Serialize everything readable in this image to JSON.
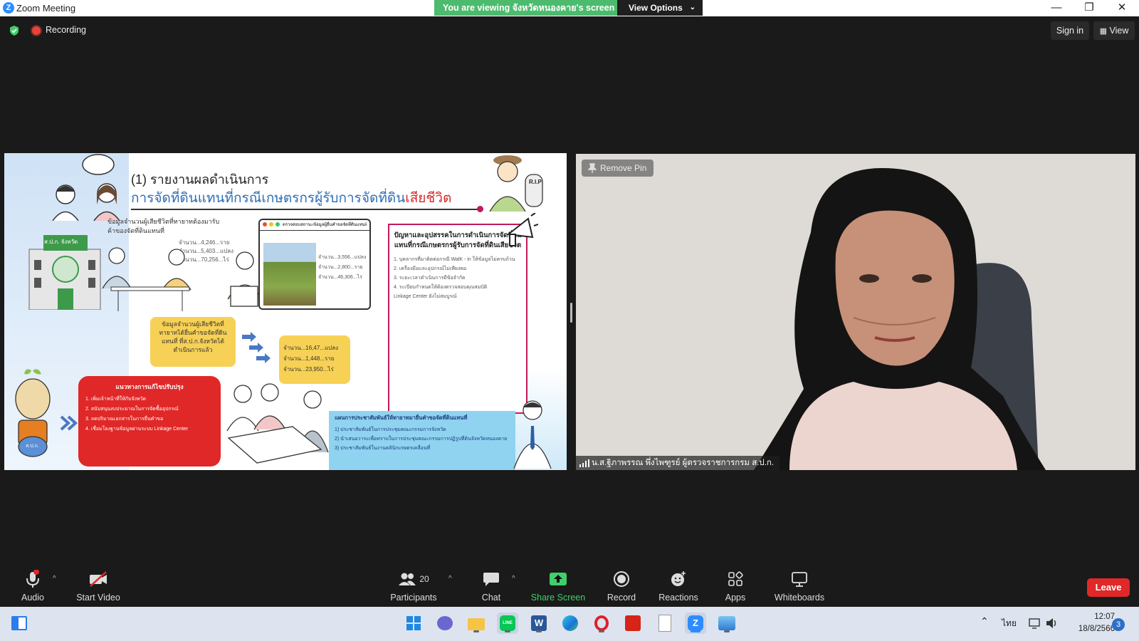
{
  "window": {
    "app_title": "Zoom Meeting",
    "viewing_banner": "You are viewing จังหวัดหนองคาย's screen",
    "view_options": "View Options",
    "controls": {
      "minimize": "—",
      "restore": "❐",
      "close": "✕"
    }
  },
  "topbar": {
    "recording_label": "Recording",
    "signin_label": "Sign in",
    "view_label": "View"
  },
  "slide": {
    "heading": "(1) รายงานผลดำเนินการ",
    "subtitle_main": "การจัดที่ดินแทนที่กรณีเกษตรกรผู้รับการจัดที่ดิน",
    "subtitle_red": "เสียชีวิต",
    "box_info_title": "ข้อมูลจำนวนผู้เสียชีวิตที่ทายาทต้องมารับค้าของจัดที่ดินแทนที่",
    "box_info_lines": [
      "จำนวน...4,246...ราย",
      "จำนวน...5,403...แปลง",
      "จำนวน...70,256...ไร่"
    ],
    "window_title": "ตรวจสอบสถานะข้อมูลผู้ยื่นคำขอจัดที่ดินแทนที่",
    "window_lines": [
      "จำนวน...3,556...แปลง",
      "จำนวน...2,800...ราย",
      "จำนวน...46,306...ไร่"
    ],
    "yellow_box_1": "ข้อมูลจำนวนผู้เสียชีวิตที่ทายาทได้ยื่นคำขอจัดที่ดินแทนที่ ที่ส.ป.ก.จังหวัดได้ดำเนินการแล้ว",
    "yellow_box_2_lines": [
      "จำนวน...16,47...แปลง",
      "จำนวน...1,448...ราย",
      "จำนวน...23,950...ไร่"
    ],
    "problems_title": "ปัญหาและอุปสรรคในการดำเนินการจัดที่ดินแทนที่กรณีเกษตรกรผู้รับการจัดที่ดินเสียชีวิต",
    "problems_lines": [
      "1. บุคลากรที่มาติดต่อกรณี WalK - in ให้ข้อมูลไม่ครบถ้วน",
      "2. เครื่องมือและอุปกรณ์ไม่เพียงพอ",
      "3. ระยะเวลาดำเนินการมีข้อจำกัด",
      "4. ระเบียบกำหนดให้ต้องตรวจสอบคุณสมบัติ",
      "Linkage Center ยังไม่สมบูรณ์"
    ],
    "red_box_title": "แนวทางการแก้ไขปรับปรุง",
    "red_box_lines": [
      "1. เพิ่มเจ้าหน้าที่ให้กับจังหวัด",
      "2. สนับสนุนงบประมาณในการจัดซื้ออุปกรณ์",
      "3. ลดปริมาณเอกสารในการยื่นคำขอ",
      "4. เชื่อมโยงฐานข้อมูลผ่านระบบ Linkage Center"
    ],
    "blue_box_title": "แผนการประชาสัมพันธ์ให้ทายาทมายื่นคำขอจัดที่ดินแทนที่",
    "blue_box_lines": [
      "1) ประชาสัมพันธ์ในการประชุมคณะกรรมการจังหวัด",
      "2) นำเสนอวาระเพื่อทราบในการประชุมคณะกรรมการปฏิรูปที่ดินจังหวัดหนองคาย",
      "3) ประชาสัมพันธ์ในงานคลินิกเกษตรเคลื่อนที่"
    ],
    "office_sign": "ส.ป.ก. จังหวัด",
    "mascot_label": "ส.ป.ก.",
    "rip_label": "R.I.P"
  },
  "video": {
    "remove_pin": "Remove Pin",
    "participant_name": "น.ส.ฐิภาพรรณ พึ่งไพฑูรย์ ผู้ตรวจราชการกรม ส.ป.ก."
  },
  "toolbar": {
    "audio": "Audio",
    "start_video": "Start Video",
    "participants": "Participants",
    "participants_count": "20",
    "chat": "Chat",
    "share_screen": "Share Screen",
    "record": "Record",
    "reactions": "Reactions",
    "apps": "Apps",
    "whiteboards": "Whiteboards",
    "leave": "Leave",
    "colors": {
      "share_green": "#3fcf6b",
      "leave_red": "#e02828"
    }
  },
  "taskbar": {
    "language": "ไทย",
    "time": "12:07",
    "date": "18/8/2566",
    "notification_count": "3"
  }
}
